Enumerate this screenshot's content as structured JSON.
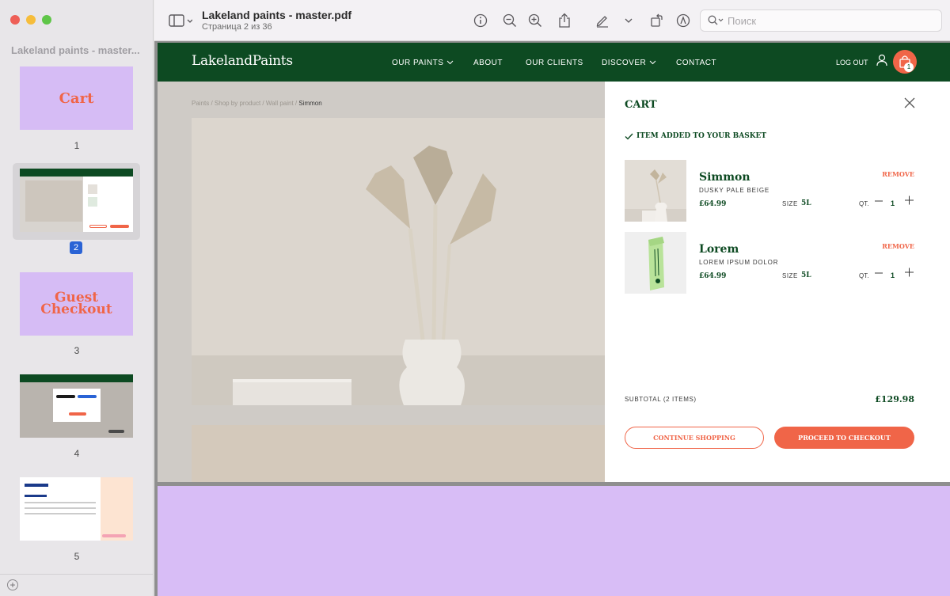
{
  "window": {
    "doc_title": "Lakeland paints - master.pdf",
    "page_info": "Страница 2 из 36",
    "search_placeholder": "Поиск"
  },
  "sidebar": {
    "title": "Lakeland paints - master...",
    "pages": [
      {
        "num": "1",
        "label": "Cart"
      },
      {
        "num": "2",
        "label": ""
      },
      {
        "num": "3",
        "label": "Guest Checkout"
      },
      {
        "num": "4",
        "label": ""
      },
      {
        "num": "5",
        "label": ""
      }
    ]
  },
  "site": {
    "logo": "LakelandPaints",
    "nav": [
      "OUR PAINTS",
      "ABOUT",
      "OUR CLIENTS",
      "DISCOVER",
      "CONTACT"
    ],
    "logout": "LOG OUT",
    "cart_count": "1",
    "breadcrumb": "Paints / Shop by product / Wall paint / ",
    "breadcrumb_current": "Simmon"
  },
  "cart": {
    "title": "CART",
    "added_msg": "ITEM ADDED TO YOUR BASKET",
    "items": [
      {
        "name": "Simmon",
        "desc": "DUSKY PALE BEIGE",
        "price": "£64.99",
        "size_label": "SIZE",
        "size": "5L",
        "remove": "REMOVE",
        "qty_label": "QT.",
        "qty": "1"
      },
      {
        "name": "Lorem",
        "desc": "LOREM IPSUM DOLOR",
        "price": "£64.99",
        "size_label": "SIZE",
        "size": "5L",
        "remove": "REMOVE",
        "qty_label": "QT.",
        "qty": "1"
      }
    ],
    "subtotal_label": "SUBTOTAL (2 ITEMS)",
    "subtotal": "£129.98",
    "continue_label": "CONTINUE SHOPPING",
    "checkout_label": "PROCEED TO CHECKOUT"
  },
  "colors": {
    "brand_green": "#0d4a22",
    "accent_orange": "#f06548",
    "lilac": "#d6bcf5"
  }
}
